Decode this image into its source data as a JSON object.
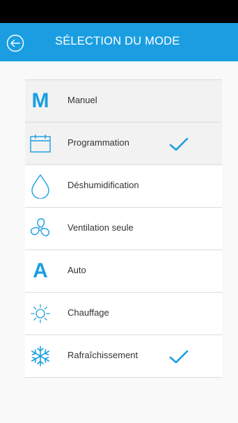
{
  "header": {
    "title": "SÉLECTION DU MODE",
    "back_icon": "back-arrow-icon"
  },
  "colors": {
    "accent": "#1b9ee1",
    "header_bg": "#1b9ee1",
    "status_bar": "#000000",
    "highlight_row": "#f2f2f2"
  },
  "modes": [
    {
      "label": "Manuel",
      "icon": "letter-m-icon",
      "glyph": "M",
      "highlighted": true,
      "checked": false
    },
    {
      "label": "Programmation",
      "icon": "calendar-icon",
      "highlighted": true,
      "checked": true
    },
    {
      "label": "Déshumidification",
      "icon": "water-drop-icon",
      "highlighted": false,
      "checked": false
    },
    {
      "label": "Ventilation seule",
      "icon": "fan-icon",
      "highlighted": false,
      "checked": false
    },
    {
      "label": "Auto",
      "icon": "letter-a-icon",
      "glyph": "A",
      "highlighted": false,
      "checked": false
    },
    {
      "label": "Chauffage",
      "icon": "sun-icon",
      "highlighted": false,
      "checked": false
    },
    {
      "label": "Rafraîchissement",
      "icon": "snowflake-icon",
      "highlighted": false,
      "checked": true
    }
  ]
}
